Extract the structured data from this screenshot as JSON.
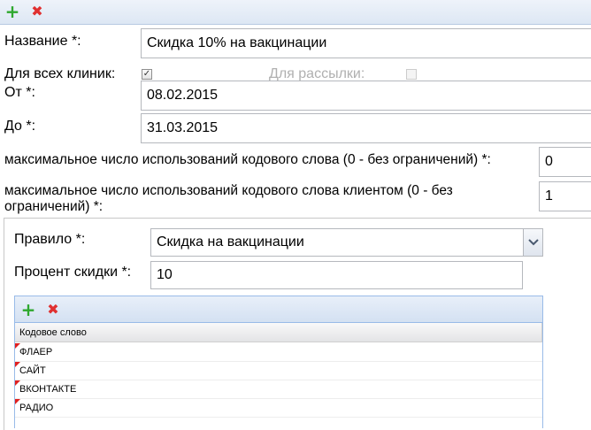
{
  "toolbar": {
    "add_icon": "plus-icon",
    "delete_icon": "x-icon"
  },
  "form": {
    "name_label": "Название *:",
    "name_value": "Скидка 10% на вакцинации",
    "all_clinics_label": "Для всех клиник:",
    "all_clinics_checked": true,
    "mailing_label": "Для рассылки:",
    "mailing_checked": false,
    "from_label": "От *:",
    "from_value": "08.02.2015",
    "to_label": "До *:",
    "to_value": "31.03.2015",
    "max_uses_label": "максимальное число использований кодового слова (0 - без ограничений) *:",
    "max_uses_value": "0",
    "max_uses_client_label_line1": "максимальное число использований кодового слова клиентом (0 - без",
    "max_uses_client_label_line2": "ограничений) *:",
    "max_uses_client_value": "1"
  },
  "rule": {
    "rule_label": "Правило *:",
    "rule_value": "Скидка на вакцинации",
    "discount_label": "Процент скидки *:",
    "discount_value": "10"
  },
  "grid": {
    "column_header": "Кодовое слово",
    "rows": [
      "ФЛАЕР",
      "САЙТ",
      "ВКОНТАКТЕ",
      "РАДИО"
    ]
  },
  "colors": {
    "add": "#2ea82e",
    "delete": "#e03030",
    "grid_border": "#99bbe8",
    "dirty_marker": "#e02020"
  }
}
